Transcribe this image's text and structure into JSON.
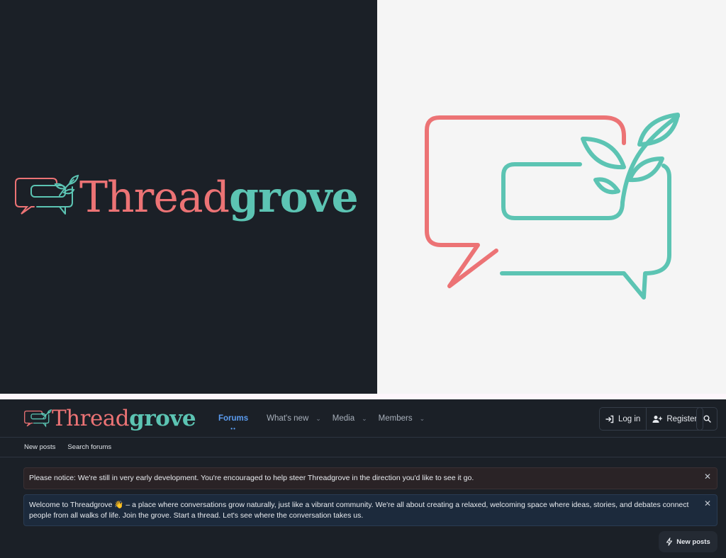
{
  "brand": {
    "name_part1": "Thread",
    "name_part2": "grove",
    "coral": "#ec7375",
    "teal": "#5cc4b3"
  },
  "nav": {
    "tabs": [
      {
        "label": "Forums",
        "active": true
      },
      {
        "label": "What's new",
        "dropdown": true
      },
      {
        "label": "Media",
        "dropdown": true
      },
      {
        "label": "Members",
        "dropdown": true
      }
    ],
    "login_label": "Log in",
    "register_label": "Register"
  },
  "subnav": {
    "items": [
      "New posts",
      "Search forums"
    ]
  },
  "notices": [
    {
      "text": "Please notice: We're still in very early development. You're encouraged to help steer Threadgrove in the direction you'd like to see it go."
    },
    {
      "text": "Welcome to Threadgrove 👋 – a place where conversations grow naturally, just like a vibrant community. We're all about creating a relaxed, welcoming space where ideas, stories, and debates connect people from all walks of life. Join the grove. Start a thread. Let's see where the conversation takes us."
    }
  ],
  "floating": {
    "new_posts_label": "New posts"
  },
  "icons": {
    "login": "login-arrow-icon",
    "register": "user-plus-icon",
    "search": "search-icon",
    "close": "close-icon",
    "new_posts": "lightning-icon"
  }
}
